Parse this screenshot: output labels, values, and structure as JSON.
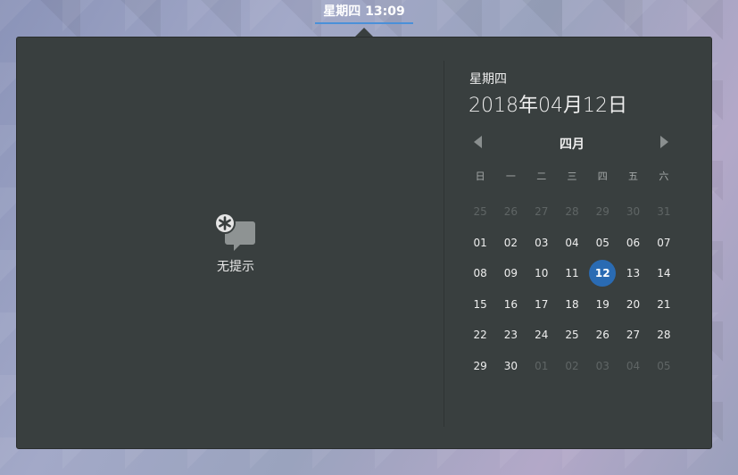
{
  "topbar": {
    "clock": "星期四 13:09"
  },
  "notifications": {
    "empty_label": "无提示",
    "icon": "no-notifications-icon"
  },
  "date": {
    "weekday": "星期四",
    "full": "2018年04月12日"
  },
  "calendar": {
    "month": "四月",
    "prev_icon": "triangle-left-icon",
    "next_icon": "triangle-right-icon",
    "weekdays": [
      "日",
      "一",
      "二",
      "三",
      "四",
      "五",
      "六"
    ],
    "weeks": [
      [
        {
          "d": "25",
          "o": true
        },
        {
          "d": "26",
          "o": true
        },
        {
          "d": "27",
          "o": true
        },
        {
          "d": "28",
          "o": true
        },
        {
          "d": "29",
          "o": true
        },
        {
          "d": "30",
          "o": true
        },
        {
          "d": "31",
          "o": true
        }
      ],
      [
        {
          "d": "01"
        },
        {
          "d": "02"
        },
        {
          "d": "03"
        },
        {
          "d": "04"
        },
        {
          "d": "05"
        },
        {
          "d": "06"
        },
        {
          "d": "07"
        }
      ],
      [
        {
          "d": "08"
        },
        {
          "d": "09"
        },
        {
          "d": "10"
        },
        {
          "d": "11"
        },
        {
          "d": "12",
          "t": true
        },
        {
          "d": "13"
        },
        {
          "d": "14"
        }
      ],
      [
        {
          "d": "15"
        },
        {
          "d": "16"
        },
        {
          "d": "17"
        },
        {
          "d": "18"
        },
        {
          "d": "19"
        },
        {
          "d": "20"
        },
        {
          "d": "21"
        }
      ],
      [
        {
          "d": "22"
        },
        {
          "d": "23"
        },
        {
          "d": "24"
        },
        {
          "d": "25"
        },
        {
          "d": "26"
        },
        {
          "d": "27"
        },
        {
          "d": "28"
        }
      ],
      [
        {
          "d": "29"
        },
        {
          "d": "30"
        },
        {
          "d": "01",
          "o": true
        },
        {
          "d": "02",
          "o": true
        },
        {
          "d": "03",
          "o": true
        },
        {
          "d": "04",
          "o": true
        },
        {
          "d": "05",
          "o": true
        }
      ]
    ],
    "accent_color": "#2a6bb3"
  }
}
